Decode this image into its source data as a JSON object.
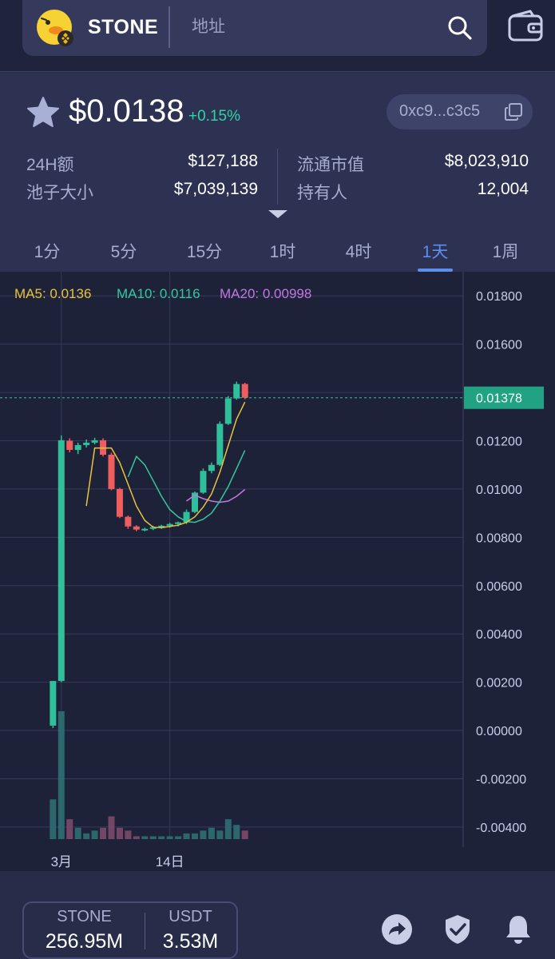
{
  "header": {
    "token_name": "STONE",
    "address_placeholder": "地址",
    "logo_icon": "duck-coin-logo-icon",
    "search_icon": "search-icon",
    "wallet_icon": "wallet-icon"
  },
  "summary": {
    "price": "$0.0138",
    "change": "+0.15%",
    "contract_address": "0xc9...c3c5",
    "stats": [
      {
        "label": "24H额",
        "value": "$127,188"
      },
      {
        "label": "池子大小",
        "value": "$7,039,139"
      },
      {
        "label": "流通市值",
        "value": "$8,023,910"
      },
      {
        "label": "持有人",
        "value": "12,004"
      }
    ]
  },
  "timeframes": {
    "items": [
      "1分",
      "5分",
      "15分",
      "1时",
      "4时",
      "1天",
      "1周"
    ],
    "active": "1天"
  },
  "chart_data": {
    "type": "candlestick",
    "moving_averages": [
      {
        "label": "MA5: 0.0136",
        "color": "#e8c33d"
      },
      {
        "label": "MA10: 0.0116",
        "color": "#35c7a0"
      },
      {
        "label": "MA20: 0.00998",
        "color": "#c277e0"
      }
    ],
    "current_price_label": "0.01378",
    "y_tick_labels": [
      "0.01800",
      "0.01600",
      "0.01400",
      "0.01200",
      "0.01000",
      "0.00800",
      "0.00600",
      "0.00400",
      "0.00200",
      "0.00000",
      "-0.00200",
      "-0.00400"
    ],
    "y_ticks": [
      0.018,
      0.016,
      0.014,
      0.012,
      0.01,
      0.008,
      0.006,
      0.004,
      0.002,
      0.0,
      -0.002,
      -0.004
    ],
    "ylim": [
      -0.0045,
      0.019
    ],
    "current_price": 0.01378,
    "x_tick_labels": [
      {
        "label": "3月",
        "index": 4
      },
      {
        "label": "14日",
        "index": 17
      }
    ],
    "candles": [
      {
        "o": 0.0,
        "h": 0.0,
        "l": 0.0,
        "c": 0.0
      },
      {
        "o": 0.0,
        "h": 0.0,
        "l": 0.0,
        "c": 0.0
      },
      {
        "o": 0.0,
        "h": 0.0,
        "l": 0.0,
        "c": 0.0
      },
      {
        "o": 0.0002,
        "h": 0.00205,
        "l": 0.0001,
        "c": 0.00205
      },
      {
        "o": 0.00205,
        "h": 0.01222,
        "l": 0.002,
        "c": 0.01202
      },
      {
        "o": 0.012,
        "h": 0.0121,
        "l": 0.01152,
        "c": 0.01162
      },
      {
        "o": 0.01162,
        "h": 0.01192,
        "l": 0.01145,
        "c": 0.01182
      },
      {
        "o": 0.01182,
        "h": 0.01205,
        "l": 0.01172,
        "c": 0.01192
      },
      {
        "o": 0.01192,
        "h": 0.01212,
        "l": 0.01185,
        "c": 0.01202
      },
      {
        "o": 0.01202,
        "h": 0.0121,
        "l": 0.01135,
        "c": 0.01142
      },
      {
        "o": 0.01142,
        "h": 0.0115,
        "l": 0.00995,
        "c": 0.01
      },
      {
        "o": 0.01,
        "h": 0.01005,
        "l": 0.0088,
        "c": 0.00885
      },
      {
        "o": 0.00885,
        "h": 0.0089,
        "l": 0.00835,
        "c": 0.00845
      },
      {
        "o": 0.00845,
        "h": 0.0085,
        "l": 0.00825,
        "c": 0.00832
      },
      {
        "o": 0.00832,
        "h": 0.0084,
        "l": 0.00825,
        "c": 0.00835
      },
      {
        "o": 0.00835,
        "h": 0.00848,
        "l": 0.0083,
        "c": 0.00842
      },
      {
        "o": 0.00842,
        "h": 0.00852,
        "l": 0.00835,
        "c": 0.00848
      },
      {
        "o": 0.00848,
        "h": 0.0086,
        "l": 0.0084,
        "c": 0.00855
      },
      {
        "o": 0.00855,
        "h": 0.00865,
        "l": 0.00845,
        "c": 0.00862
      },
      {
        "o": 0.00862,
        "h": 0.00915,
        "l": 0.00855,
        "c": 0.00905
      },
      {
        "o": 0.00905,
        "h": 0.0099,
        "l": 0.009,
        "c": 0.00985
      },
      {
        "o": 0.00985,
        "h": 0.01085,
        "l": 0.0098,
        "c": 0.01075
      },
      {
        "o": 0.01075,
        "h": 0.0111,
        "l": 0.01065,
        "c": 0.011
      },
      {
        "o": 0.011,
        "h": 0.0128,
        "l": 0.01095,
        "c": 0.0127
      },
      {
        "o": 0.0127,
        "h": 0.01385,
        "l": 0.01265,
        "c": 0.01375
      },
      {
        "o": 0.01375,
        "h": 0.01445,
        "l": 0.0137,
        "c": 0.01435
      },
      {
        "o": 0.01435,
        "h": 0.0144,
        "l": 0.01372,
        "c": 0.01378
      }
    ],
    "volumes": [
      0,
      0,
      0,
      14,
      45,
      7,
      4,
      2,
      3,
      4,
      8,
      4,
      3,
      1,
      1,
      1,
      1,
      1,
      1,
      2,
      2,
      3,
      4,
      3,
      7,
      5,
      3
    ],
    "ma5": [
      null,
      null,
      null,
      null,
      null,
      null,
      null,
      0.0093,
      0.0117,
      0.0117,
      0.0117,
      0.0111,
      0.0102,
      0.0093,
      0.0087,
      0.00842,
      0.0084,
      0.00845,
      0.0085,
      0.00862,
      0.00885,
      0.00925,
      0.0098,
      0.0107,
      0.0118,
      0.0129,
      0.0136
    ],
    "ma10": [
      null,
      null,
      null,
      null,
      null,
      null,
      null,
      null,
      null,
      null,
      null,
      null,
      0.0105,
      0.01135,
      0.011,
      0.01035,
      0.0097,
      0.00915,
      0.00885,
      0.00865,
      0.00862,
      0.00875,
      0.009,
      0.0095,
      0.0101,
      0.01085,
      0.0116
    ],
    "ma20": [
      null,
      null,
      null,
      null,
      null,
      null,
      null,
      null,
      null,
      null,
      null,
      null,
      null,
      null,
      null,
      null,
      null,
      null,
      null,
      0.0095,
      0.00975,
      0.0096,
      0.0095,
      0.00945,
      0.0095,
      0.0097,
      0.00998
    ]
  },
  "footer": {
    "base_label": "STONE",
    "base_volume": "256.95M",
    "quote_label": "USDT",
    "quote_volume": "3.53M",
    "share_icon": "share-icon",
    "shield_icon": "shield-check-icon",
    "bell_icon": "bell-icon"
  },
  "colors": {
    "up": "#2fbf9b",
    "down": "#f05d5e",
    "accent": "#5d8dee",
    "background": "#1e2238"
  }
}
